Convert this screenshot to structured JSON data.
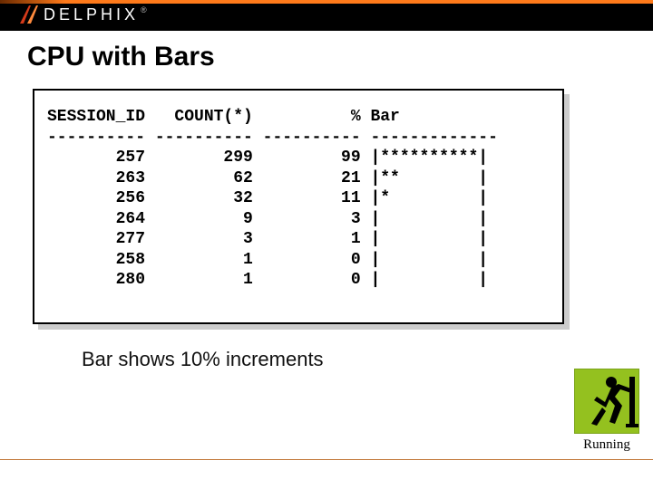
{
  "logo": {
    "text": "DELPHIX",
    "registered": "®"
  },
  "title": "CPU with Bars",
  "headers": {
    "session_id": "SESSION_ID",
    "count": "COUNT(*)",
    "pct": "%",
    "bar": "Bar"
  },
  "separators": {
    "col1": "----------",
    "col2": "----------",
    "col3": "----------",
    "col4": "-------------"
  },
  "rows": [
    {
      "session_id": 257,
      "count": 299,
      "pct": 99,
      "bar": "|**********|"
    },
    {
      "session_id": 263,
      "count": 62,
      "pct": 21,
      "bar": "|**        |"
    },
    {
      "session_id": 256,
      "count": 32,
      "pct": 11,
      "bar": "|*         |"
    },
    {
      "session_id": 264,
      "count": 9,
      "pct": 3,
      "bar": "|          |"
    },
    {
      "session_id": 277,
      "count": 3,
      "pct": 1,
      "bar": "|          |"
    },
    {
      "session_id": 258,
      "count": 1,
      "pct": 0,
      "bar": "|          |"
    },
    {
      "session_id": 280,
      "count": 1,
      "pct": 0,
      "bar": "|          |"
    }
  ],
  "caption": "Bar shows 10% increments",
  "running_label": "Running",
  "chart_data": {
    "type": "table",
    "title": "CPU with Bars",
    "columns": [
      "SESSION_ID",
      "COUNT(*)",
      "%",
      "Bar"
    ],
    "rows": [
      [
        257,
        299,
        99,
        "**********"
      ],
      [
        263,
        62,
        21,
        "**"
      ],
      [
        256,
        32,
        11,
        "*"
      ],
      [
        264,
        9,
        3,
        ""
      ],
      [
        277,
        3,
        1,
        ""
      ],
      [
        258,
        1,
        0,
        ""
      ],
      [
        280,
        1,
        0,
        ""
      ]
    ],
    "bar_note": "Each * represents a 10% increment",
    "pct_range": [
      0,
      100
    ]
  }
}
